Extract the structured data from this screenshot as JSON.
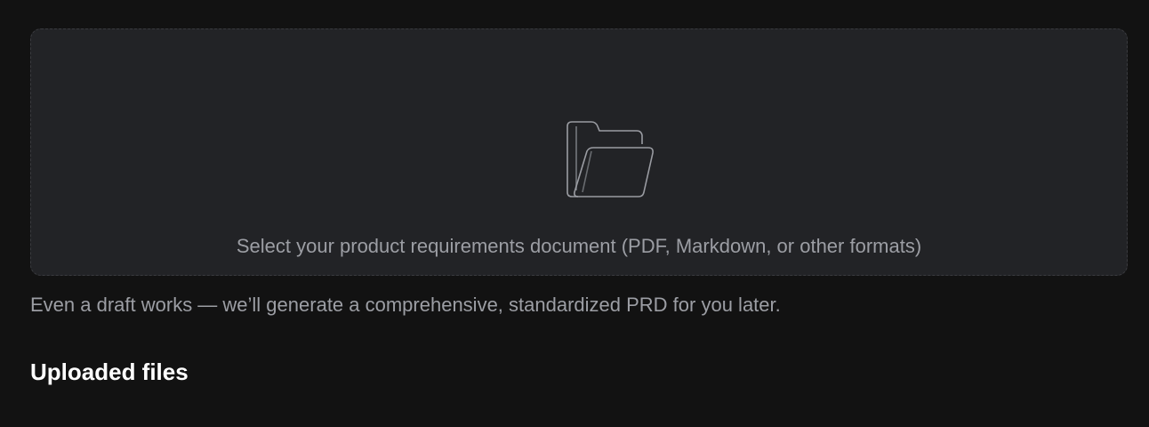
{
  "upload": {
    "icon": "folder-icon",
    "prompt": "Select your product requirements document (PDF, Markdown, or other formats)",
    "helper": "Even a draft works — we’ll generate a comprehensive, standardized PRD for you later."
  },
  "uploaded_files": {
    "title": "Uploaded files"
  },
  "colors": {
    "page_background": "#121212",
    "dropzone_background": "#222326",
    "dropzone_border": "#3a3b3f",
    "muted_text": "#9c9ea4",
    "heading_text": "#ffffff",
    "icon_stroke": "#9a9ca2"
  }
}
